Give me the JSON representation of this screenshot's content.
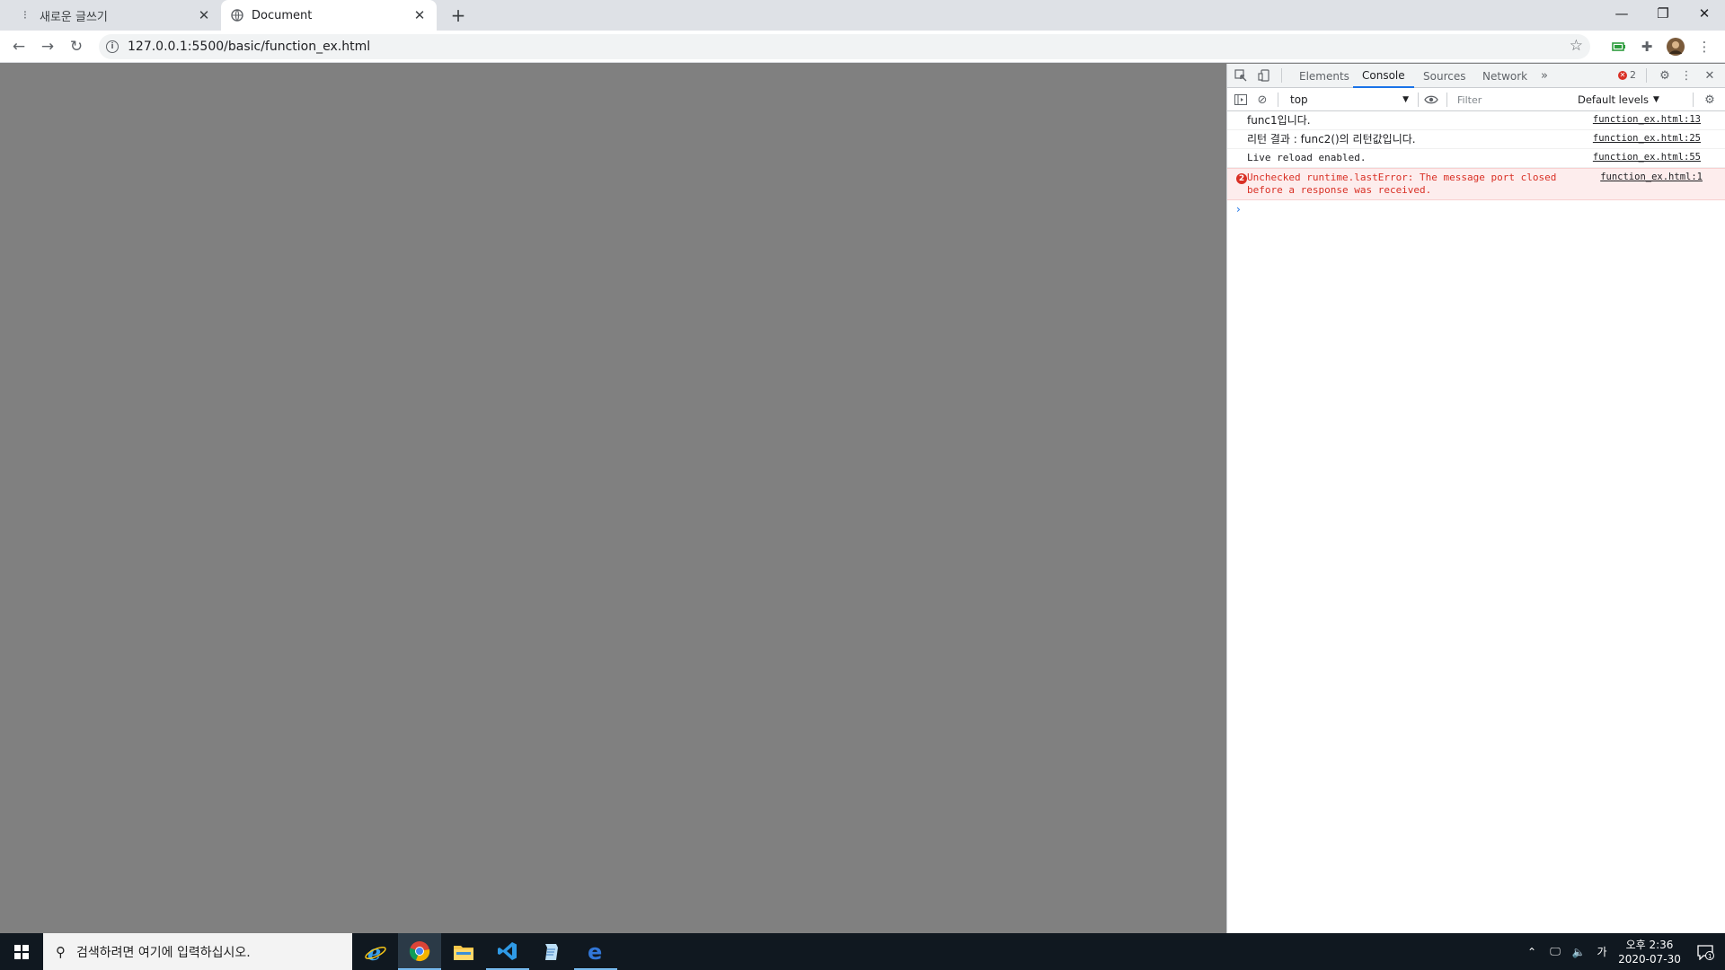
{
  "browser": {
    "tabs": [
      {
        "title": "새로운 글쓰기",
        "favicon": "app-icon",
        "active": false
      },
      {
        "title": "Document",
        "favicon": "globe-icon",
        "active": true
      }
    ],
    "url": "127.0.0.1:5500/basic/function_ex.html"
  },
  "devtools": {
    "tabs": [
      "Elements",
      "Console",
      "Sources",
      "Network"
    ],
    "active_tab": "Console",
    "error_count": "2",
    "context": "top",
    "filter_placeholder": "Filter",
    "levels": "Default levels",
    "console": [
      {
        "type": "log",
        "message": "func1입니다.",
        "source": "function_ex.html:13"
      },
      {
        "type": "log",
        "message": "리턴 결과 : func2()의 리턴값입니다.",
        "source": "function_ex.html:25"
      },
      {
        "type": "log",
        "message": "Live reload enabled.",
        "source": "function_ex.html:55"
      },
      {
        "type": "error",
        "badge": "2",
        "message": "Unchecked runtime.lastError: The message port closed before a response was received.",
        "source": "function_ex.html:1"
      }
    ]
  },
  "taskbar": {
    "search_placeholder": "검색하려면 여기에 입력하십시오.",
    "ime": "가",
    "time_period": "오후 2:36",
    "date": "2020-07-30",
    "notification_count": "1"
  },
  "colors": {
    "accent": "#1a73e8",
    "error": "#d93025",
    "viewport_bg": "#808080",
    "taskbar_bg": "#101820"
  }
}
